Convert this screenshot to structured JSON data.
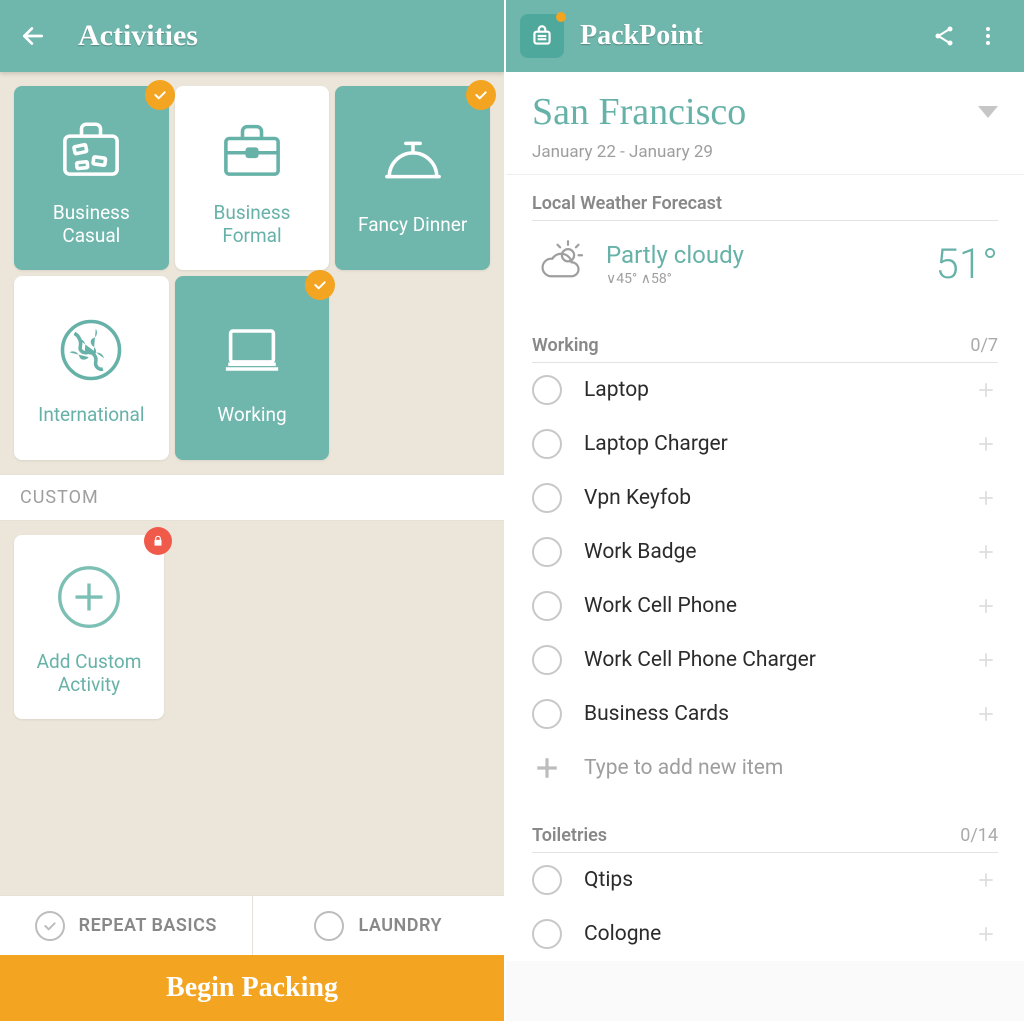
{
  "left": {
    "appbar": {
      "title": "Activities",
      "back_icon_name": "back-arrow-icon"
    },
    "activities": [
      {
        "label": "Business Casual",
        "selected": true,
        "icon": "suitcase-travel-icon"
      },
      {
        "label": "Business Formal",
        "selected": false,
        "icon": "briefcase-icon"
      },
      {
        "label": "Fancy Dinner",
        "selected": true,
        "icon": "cloche-icon"
      },
      {
        "label": "International",
        "selected": false,
        "icon": "globe-icon"
      },
      {
        "label": "Working",
        "selected": true,
        "icon": "laptop-icon"
      }
    ],
    "custom_header": "CUSTOM",
    "custom_tile": {
      "label": "Add Custom Activity",
      "icon": "plus-circle-icon",
      "locked": true,
      "lock_icon": "lock-icon"
    },
    "bottom_options": [
      {
        "label": "REPEAT BASICS",
        "checked": true
      },
      {
        "label": "LAUNDRY",
        "checked": false
      }
    ],
    "begin_button": "Begin Packing"
  },
  "right": {
    "appbar": {
      "title": "PackPoint",
      "app_icon_name": "packpoint-app-icon",
      "share_icon_name": "share-icon",
      "overflow_icon_name": "overflow-menu-icon"
    },
    "trip": {
      "city": "San Francisco",
      "dates": "January 22 - January 29"
    },
    "weather": {
      "section_title": "Local Weather Forecast",
      "condition": "Partly cloudy",
      "low": "∨45°",
      "high": "∧58°",
      "temp": "51°",
      "icon_name": "partly-cloudy-icon"
    },
    "categories": [
      {
        "title": "Working",
        "count": "0/7",
        "items": [
          {
            "label": "Laptop"
          },
          {
            "label": "Laptop Charger"
          },
          {
            "label": "Vpn Keyfob"
          },
          {
            "label": "Work Badge"
          },
          {
            "label": "Work Cell Phone"
          },
          {
            "label": "Work Cell Phone Charger"
          },
          {
            "label": "Business Cards"
          }
        ],
        "add_placeholder": "Type to add new item"
      },
      {
        "title": "Toiletries",
        "count": "0/14",
        "items": [
          {
            "label": "Qtips"
          },
          {
            "label": "Cologne"
          }
        ]
      }
    ]
  }
}
